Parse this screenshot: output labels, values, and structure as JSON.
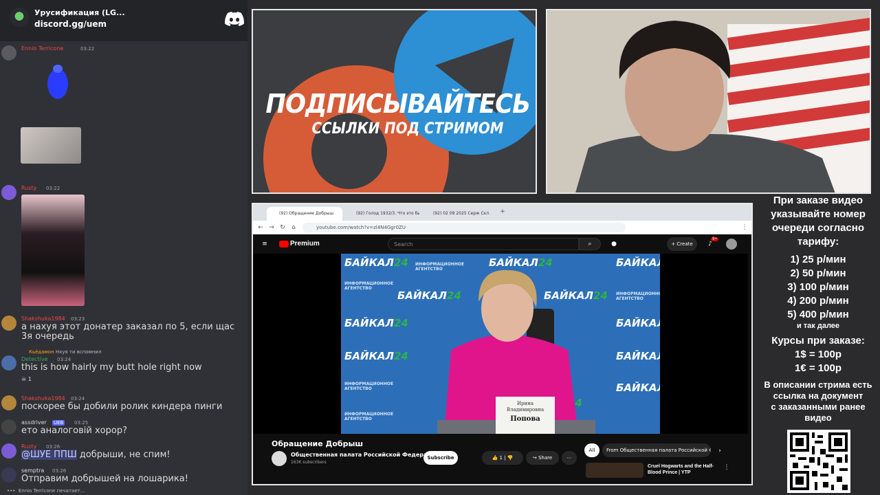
{
  "discord": {
    "server_name": "Урусификация (LG...",
    "server_link": "discord.gg/uem",
    "messages": [
      {
        "author": "Ennio Terricone",
        "time": "03:22",
        "color": "#f04747"
      },
      {
        "author": "Rusty",
        "time": "03:22",
        "color": "#f04747"
      },
      {
        "author": "Shakshuka1984",
        "time": "03:23",
        "color": "#f04747",
        "text": "а нахуя этот донатер заказал по 5, если щас 3я очередь"
      },
      {
        "reply_author": "Кьёдамон",
        "reply_text": "Нхуя ти вспомнил",
        "author": "Detective",
        "time": "03:24",
        "color": "#3ba55d",
        "text": "this is how hairly my butt hole right now",
        "reaction_count": "1"
      },
      {
        "author": "Shakshuka1984",
        "time": "03:24",
        "color": "#f04747",
        "text": "поскорее бы добили ролик киндера пинги"
      },
      {
        "author": "assdriver",
        "badge": "UEB",
        "time": "03:25",
        "color": "#dcddde",
        "text": "ето аналоговій хорор?"
      },
      {
        "author": "Rusty",
        "time": "03:26",
        "color": "#f04747",
        "text_mention": "@ШУЕ ППШ",
        "text": " добрыши, не спим!"
      },
      {
        "author": "semptra",
        "time": "03:26",
        "color": "#dcddde",
        "text": "Отправим добрышей на лошарика!"
      }
    ],
    "typing": "Ennio Terricone печатает..."
  },
  "promo": {
    "title": "ПОДПИСЫВАЙТЕСЬ",
    "subtitle": "ССЫЛКИ ПОД СТРИМОМ"
  },
  "browser": {
    "tabs": [
      "(92) Обращение Добрыш",
      "(92) Голод 1932/3. Что это бы",
      "(92) 02 09 2025 Серж Скл"
    ],
    "url": "youtube.com/watch?v=zl4N4Ggr0ZU",
    "search_placeholder": "Search",
    "premium_label": "Premium",
    "create_label": "Create",
    "notif_badge": "9+"
  },
  "video": {
    "brand": "БАЙКАЛ",
    "brand_num": "24",
    "agency_line1": "ИНФОРМАЦИОННОЕ",
    "agency_line2": "АГЕНТСТВО",
    "nameplate_first": "Ирина",
    "nameplate_middle": "Владимировна",
    "nameplate_last": "Попова",
    "title": "Обращение Добрыш",
    "channel": "Общественная палата Российской Федерации",
    "subs": "163K subscribers",
    "subscribe": "Subscribe",
    "likes": "1",
    "share": "Share",
    "chip_all": "All",
    "chip_from": "From Общественная палата Российской Фе",
    "rec_title_1": "Cruel Hogwarts and the Half-",
    "rec_title_2": "Blood Prince | YTP"
  },
  "info": {
    "intro": [
      "При заказе видео",
      "указывайте номер",
      "очереди согласно",
      "тарифу:"
    ],
    "tariffs": [
      "1) 25 р/мин",
      "2) 50 р/мин",
      "3) 100 р/мин",
      "4) 200 р/мин",
      "5) 400 р/мин"
    ],
    "etc": "и так далее",
    "rates_title": "Курсы при заказе:",
    "rates": [
      "1$ = 100р",
      "1€ = 100р"
    ],
    "desc": [
      "В описании стрима есть",
      "ссылка на документ",
      "с заказанными ранее",
      "видео"
    ]
  }
}
